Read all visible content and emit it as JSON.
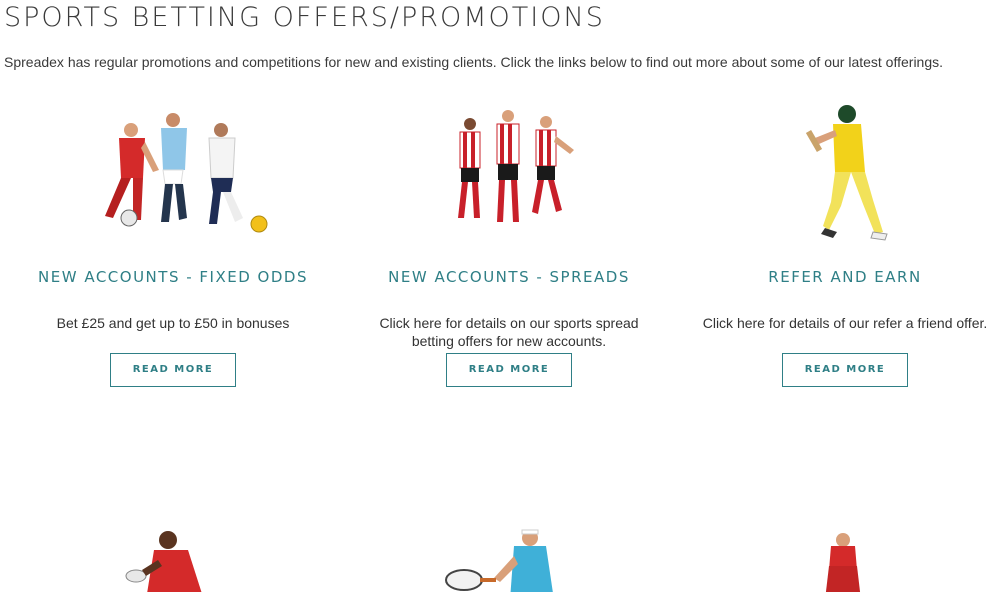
{
  "page": {
    "title": "SPORTS BETTING OFFERS/PROMOTIONS",
    "intro": "Spreadex has regular promotions and competitions for new and existing clients. Click the links below to find out more about some of our latest offerings."
  },
  "offers": [
    {
      "title": "NEW ACCOUNTS - FIXED ODDS",
      "description": "Bet £25 and get up to £50 in bonuses",
      "button": "READ MORE",
      "image": "footballers-illustration"
    },
    {
      "title": "NEW ACCOUNTS - SPREADS",
      "description": "Click here for details on our sports spread betting offers for new accounts.",
      "button": "READ MORE",
      "image": "striped-footballers-illustration"
    },
    {
      "title": "REFER AND EARN",
      "description": "Click here for details of our refer a friend offer.",
      "button": "READ MORE",
      "image": "cricketer-illustration"
    }
  ],
  "second_row": [
    {
      "image": "rugby-player-illustration"
    },
    {
      "image": "tennis-player-illustration"
    },
    {
      "image": "footballers-celebrating-illustration"
    }
  ],
  "colors": {
    "accent": "#2f7f86",
    "text": "#333333"
  }
}
